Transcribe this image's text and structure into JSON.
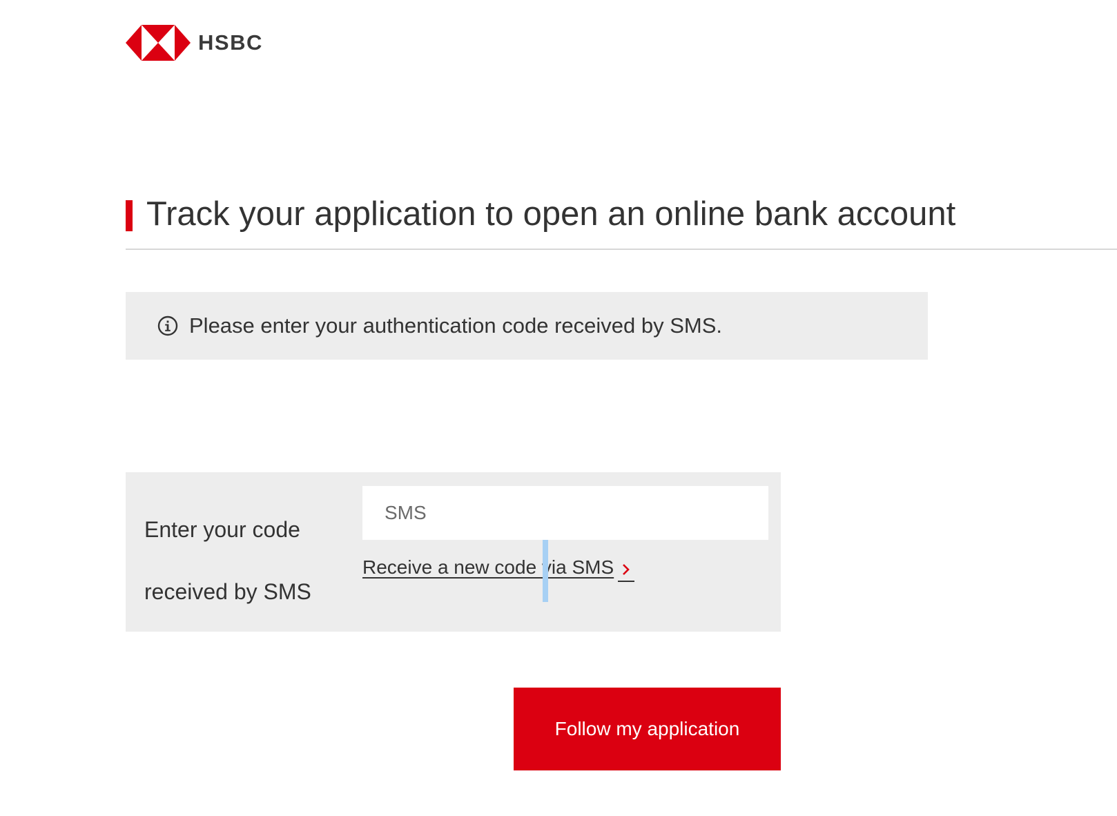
{
  "header": {
    "logo_text": "HSBC",
    "logo_icon": "hsbc-hexagon-logo",
    "brand_color": "#db0011"
  },
  "main": {
    "title": "Track your application to open an online bank account",
    "info_banner": {
      "icon": "info-icon",
      "text": "Please enter your authentication code received by SMS."
    },
    "code_form": {
      "label": "Enter your code received by SMS",
      "input_value": "",
      "input_placeholder": "SMS",
      "resend_link_text": "Receive a new code via SMS",
      "resend_link_icon": "chevron-right-icon"
    },
    "submit_button_label": "Follow my application"
  }
}
